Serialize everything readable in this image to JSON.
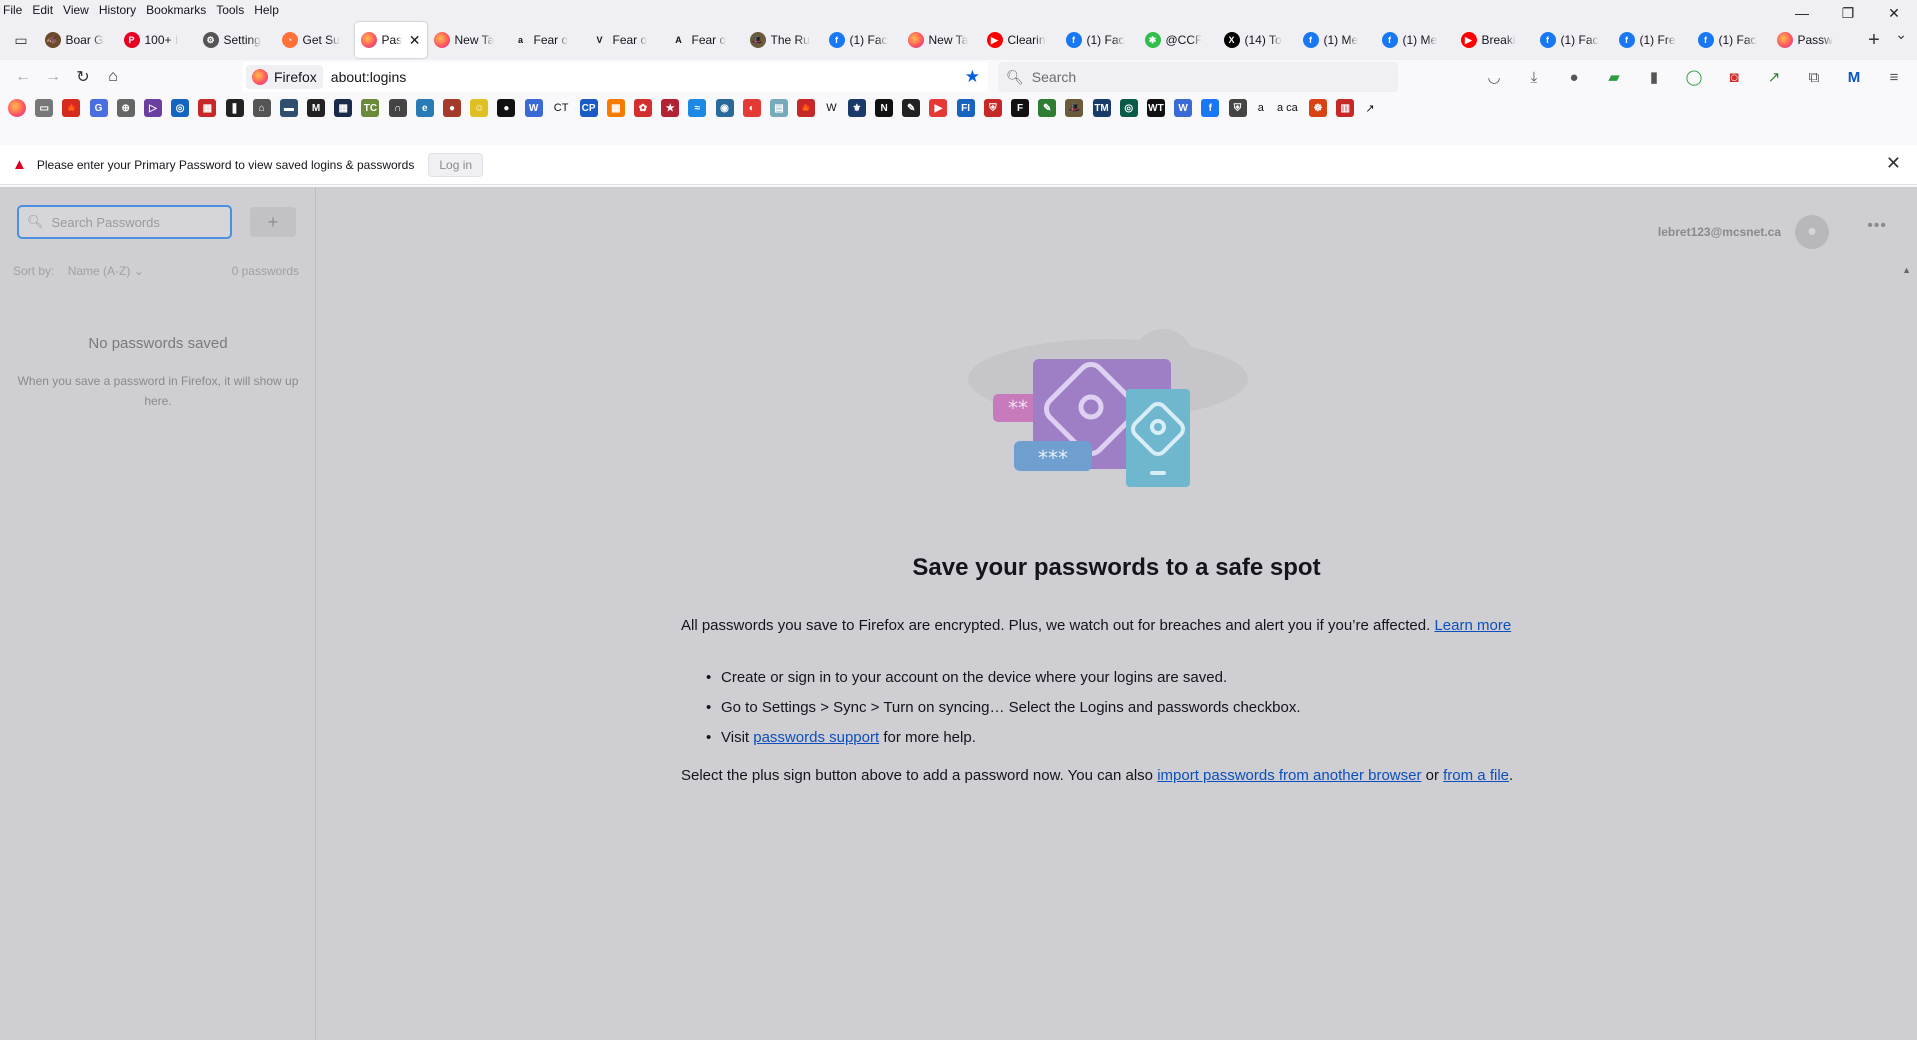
{
  "menubar": [
    "File",
    "Edit",
    "View",
    "History",
    "Bookmarks",
    "Tools",
    "Help"
  ],
  "window_controls": {
    "minimize": "—",
    "restore": "❐",
    "close": "✕"
  },
  "tabs": [
    {
      "label": "Boar G",
      "color": "#6a4a2a",
      "glyph": "🐗"
    },
    {
      "label": "100+ I",
      "color": "#e60023",
      "glyph": "P"
    },
    {
      "label": "Setting",
      "color": "#555555",
      "glyph": "⚙"
    },
    {
      "label": "Get Su",
      "color": "#ff7139",
      "glyph": "◔"
    },
    {
      "label": "Pas",
      "color": "#ff7139",
      "glyph": "",
      "active": true
    },
    {
      "label": "New Ta",
      "color": "#ff7139",
      "glyph": ""
    },
    {
      "label": "Fear o",
      "color": "#ffffff",
      "glyph": "a"
    },
    {
      "label": "Fear o",
      "color": "#ffffff",
      "glyph": "V"
    },
    {
      "label": "Fear o",
      "color": "#ffffff",
      "glyph": "A"
    },
    {
      "label": "The Ru",
      "color": "#6b5b3a",
      "glyph": "🎩"
    },
    {
      "label": "(1) Fac",
      "color": "#1877f2",
      "glyph": "f"
    },
    {
      "label": "New Ta",
      "color": "#ff7139",
      "glyph": ""
    },
    {
      "label": "Clearin",
      "color": "#ff0000",
      "glyph": "▶"
    },
    {
      "label": "(1) Fac",
      "color": "#1877f2",
      "glyph": "f"
    },
    {
      "label": "@CCF",
      "color": "#2fbf4a",
      "glyph": "✱"
    },
    {
      "label": "(14) To",
      "color": "#000000",
      "glyph": "X"
    },
    {
      "label": "(1) Me",
      "color": "#1877f2",
      "glyph": "f"
    },
    {
      "label": "(1) Me",
      "color": "#1877f2",
      "glyph": "f"
    },
    {
      "label": "Breaki",
      "color": "#ff0000",
      "glyph": "▶"
    },
    {
      "label": "(1) Fac",
      "color": "#1877f2",
      "glyph": "f"
    },
    {
      "label": "(1) Fre",
      "color": "#1877f2",
      "glyph": "f"
    },
    {
      "label": "(1) Fac",
      "color": "#1877f2",
      "glyph": "f"
    },
    {
      "label": "Passw",
      "color": "#ff7139",
      "glyph": ""
    }
  ],
  "newtab": "+",
  "urlbar": {
    "identity": "Firefox",
    "url": "about:logins"
  },
  "searchbar": {
    "placeholder": "Search"
  },
  "bookmarks": [
    {
      "c": "#ff7139",
      "g": ""
    },
    {
      "c": "#777777",
      "g": "▭"
    },
    {
      "c": "#d52b1e",
      "g": "🍁"
    },
    {
      "c": "#4a6ee0",
      "g": "G"
    },
    {
      "c": "#666666",
      "g": "⊕"
    },
    {
      "c": "#6b3fa0",
      "g": "▷"
    },
    {
      "c": "#1565c0",
      "g": "◎"
    },
    {
      "c": "#c62828",
      "g": "▦"
    },
    {
      "c": "#222222",
      "g": "❚"
    },
    {
      "c": "#555555",
      "g": "⌂"
    },
    {
      "c": "#2f4f6f",
      "g": "▬"
    },
    {
      "c": "#222222",
      "g": "M"
    },
    {
      "c": "#1a2a4a",
      "g": "▦"
    },
    {
      "c": "#6a8a3a",
      "g": "TC"
    },
    {
      "c": "#444444",
      "g": "∩"
    },
    {
      "c": "#2a7ab5",
      "g": "e"
    },
    {
      "c": "#a33a2a",
      "g": "●"
    },
    {
      "c": "#e0c020",
      "g": "☺"
    },
    {
      "c": "#111111",
      "g": "●"
    },
    {
      "c": "#3a6ad5",
      "g": "W"
    },
    {
      "c": "#2a2a2a",
      "g": "CT",
      "wide": true
    },
    {
      "c": "#1a5ac5",
      "g": "CP"
    },
    {
      "c": "#f57c00",
      "g": "▦"
    },
    {
      "c": "#d32f2f",
      "g": "✿"
    },
    {
      "c": "#b22234",
      "g": "★"
    },
    {
      "c": "#1e88e5",
      "g": "≈"
    },
    {
      "c": "#2a6a9a",
      "g": "◉"
    },
    {
      "c": "#e53935",
      "g": "◐"
    },
    {
      "c": "#7ab",
      "g": "▤"
    },
    {
      "c": "#c62828",
      "g": "🍁"
    },
    {
      "c": "#333333",
      "g": "W",
      "wide": true
    },
    {
      "c": "#1a3a6a",
      "g": "⚜"
    },
    {
      "c": "#111111",
      "g": "N"
    },
    {
      "c": "#222222",
      "g": "✎"
    },
    {
      "c": "#e53935",
      "g": "▶"
    },
    {
      "c": "#1565c0",
      "g": "FI"
    },
    {
      "c": "#c62828",
      "g": "⛨"
    },
    {
      "c": "#111111",
      "g": "F"
    },
    {
      "c": "#2e7d32",
      "g": "✎"
    },
    {
      "c": "#6b5b3a",
      "g": "🎩"
    },
    {
      "c": "#1a3a6a",
      "g": "TM"
    },
    {
      "c": "#0a5a4a",
      "g": "◎"
    },
    {
      "c": "#111111",
      "g": "WT"
    },
    {
      "c": "#3a6ad5",
      "g": "W"
    },
    {
      "c": "#1877f2",
      "g": "f"
    },
    {
      "c": "#444444",
      "g": "⛨"
    },
    {
      "c": "#ffffff",
      "g": "a",
      "wide": true
    },
    {
      "c": "#ffffff",
      "g": "a ca",
      "wide": true
    },
    {
      "c": "#d84315",
      "g": "☸"
    },
    {
      "c": "#c62828",
      "g": "▥"
    },
    {
      "c": "#ffffff",
      "g": "↗",
      "wide": true
    }
  ],
  "notice": {
    "message": "Please enter your Primary Password to view saved logins & passwords",
    "login_label": "Log in",
    "close": "✕"
  },
  "sidebar": {
    "search_placeholder": "Search Passwords",
    "add_label": "+",
    "sort_label": "Sort by:",
    "sort_value": "Name (A-Z)",
    "count": "0 passwords",
    "empty_title": "No passwords saved",
    "empty_body": "When you save a password in Firefox, it will show up here."
  },
  "account": {
    "email": "lebret123@mcsnet.ca",
    "menu": "•••"
  },
  "main": {
    "title": "Save your passwords to a safe spot",
    "intro": "All passwords you save to Firefox are encrypted. Plus, we watch out for breaches and alert you if you’re affected.",
    "learn_more": "Learn more",
    "bullet1": "Create or sign in to your account on the device where your logins are saved.",
    "bullet2": "Go to Settings > Sync > Turn on syncing… Select the Logins and passwords checkbox.",
    "bullet3_pre": "Visit",
    "bullet3_link": "passwords support",
    "bullet3_post": "for more help.",
    "outro_pre": "Select the plus sign button above to add a password now. You can also",
    "outro_link1": "import passwords from another browser",
    "outro_mid": "or",
    "outro_link2": "from a file",
    "outro_end": "."
  }
}
